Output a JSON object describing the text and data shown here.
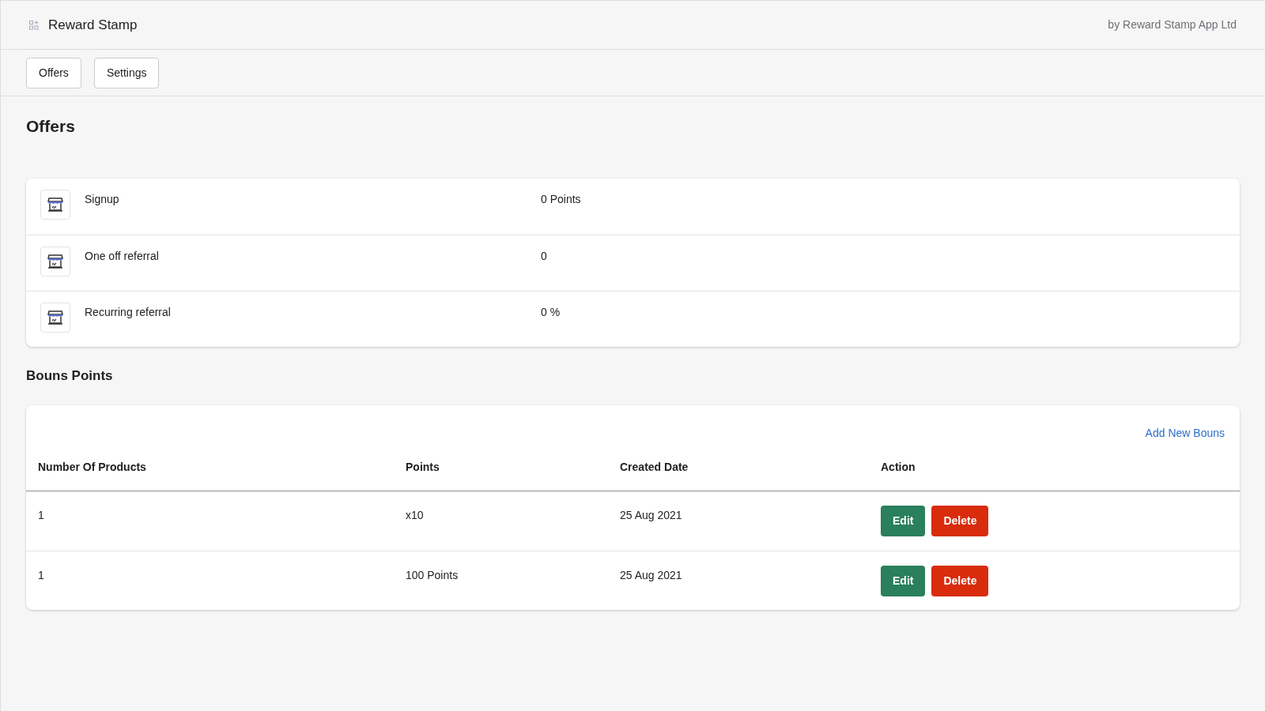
{
  "app": {
    "title": "Reward Stamp",
    "byline": "by Reward Stamp App Ltd"
  },
  "nav": [
    "Offers",
    "Settings"
  ],
  "page_title": "Offers",
  "offers": [
    {
      "name": "Signup",
      "value": "0 Points"
    },
    {
      "name": "One off referral",
      "value": "0"
    },
    {
      "name": "Recurring referral",
      "value": "0 %"
    }
  ],
  "bonus": {
    "title": "Bouns Points",
    "add_link": "Add New Bouns",
    "columns": [
      "Number Of Products",
      "Points",
      "Created Date",
      "Action"
    ],
    "rows": [
      {
        "products": "1",
        "points": "x10",
        "date": "25 Aug 2021",
        "actions": [
          "Edit",
          "Delete"
        ]
      },
      {
        "products": "1",
        "points": "100 Points",
        "date": "25 Aug 2021",
        "actions": [
          "Edit",
          "Delete"
        ]
      }
    ]
  }
}
